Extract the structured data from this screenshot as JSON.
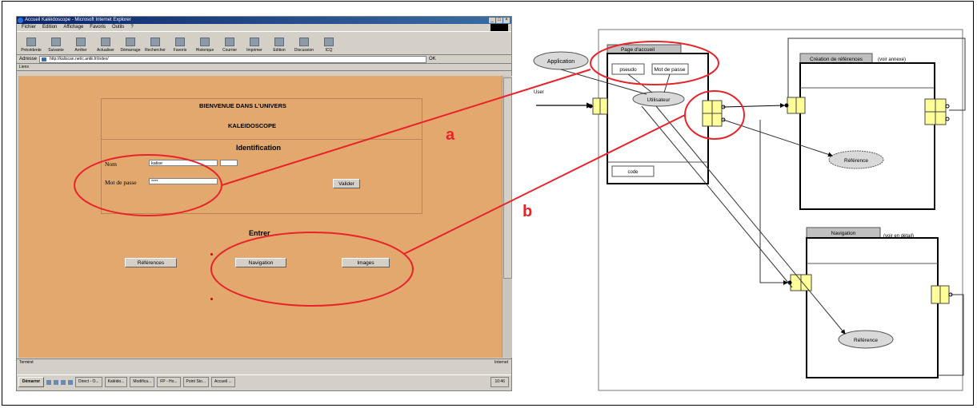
{
  "browser": {
    "title": "Accueil Kaléidoscope - Microsoft Internet Explorer",
    "window_buttons": [
      "_",
      "□",
      "×"
    ],
    "menu": [
      "Fichier",
      "Edition",
      "Affichage",
      "Favoris",
      "Outils",
      "?"
    ],
    "toolbar": [
      "Précédente",
      "Suivante",
      "Arrêter",
      "Actualiser",
      "Démarrage",
      "Rechercher",
      "Favoris",
      "Historique",
      "Courrier",
      "Imprimer",
      "Edition",
      "Discussion",
      "ICQ"
    ],
    "address_label": "Adresse",
    "address_value": "http://kaliscan.net/c.antiii.fr/index/",
    "go_label": "OK",
    "links_label": "Liens",
    "status_left": "Terminé",
    "status_zone": "Internet",
    "taskbar_start": "Démarrer",
    "taskbar_tasks": [
      "Direct - O...",
      "Kaléido...",
      "Modifica...",
      "FP - Ho...",
      "Point Sto...",
      "Accueil ..."
    ],
    "taskbar_clock": "10:46"
  },
  "page": {
    "welcome_line1": "BIENVENUE DANS L'UNIVERS",
    "welcome_line2": "KALEIDOSCOPE",
    "identification_heading": "Identification",
    "nom_label": "Nom",
    "nom_value": "kalise",
    "password_label": "Mot de passe",
    "password_value": "****",
    "validate_button": "Valider",
    "section_heading": "Entrer",
    "buttons": [
      "Références",
      "Navigation",
      "Images"
    ]
  },
  "annotations": {
    "a": "a",
    "b": "b",
    "color": "#e8232a"
  },
  "diagram": {
    "application_node": "Application",
    "user_label": "User",
    "page_accueil": {
      "title": "Page d'accueil",
      "pseudo": "pseudo",
      "password": "Mot de passe",
      "utilisateur": "Utilisateur",
      "code": "code"
    },
    "creation": {
      "title": "Création de références",
      "note": "(voir annexe)",
      "node": "Référence"
    },
    "navigation": {
      "title": "Navigation",
      "note": "(voir en détail)",
      "node": "Référence"
    },
    "port_color": "#ffff99"
  }
}
